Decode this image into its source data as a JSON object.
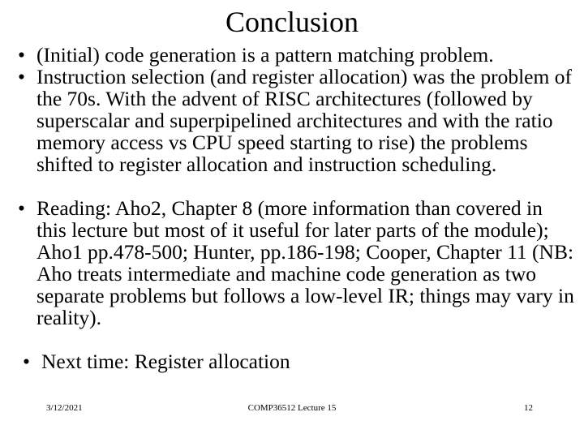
{
  "slide": {
    "title": "Conclusion",
    "bullets": [
      {
        "id": "bullet-initial-code-generation",
        "text": "(Initial) code generation is a pattern matching problem.",
        "marker": "•",
        "indent": 0,
        "gap_before": false
      },
      {
        "id": "bullet-instruction-selection",
        "text": "Instruction selection (and register allocation) was the problem of the 70s. With the advent of RISC architectures (followed by superscalar and superpipelined architectures and with the ratio memory access vs CPU speed starting to rise) the problems shifted to register allocation and instruction scheduling.",
        "marker": "•",
        "indent": 0,
        "gap_before": false
      },
      {
        "id": "bullet-reading",
        "text": "Reading: Aho2, Chapter 8 (more information than covered in this lecture but most of it useful for later parts of the module); Aho1 pp.478-500; Hunter, pp.186-198; Cooper, Chapter 11  (NB: Aho treats intermediate and machine code generation as two separate problems but follows a low-level IR; things may vary in reality).",
        "marker": "•",
        "indent": 0,
        "gap_before": true
      },
      {
        "id": "bullet-next-time",
        "text": "Next time: Register allocation",
        "marker": "•",
        "indent": 1,
        "gap_before": true
      }
    ],
    "footer": {
      "date": "3/12/2021",
      "center": "COMP36512 Lecture 15",
      "page_number": "12"
    },
    "colors": {
      "background": "#ffffff",
      "text": "#000000"
    }
  }
}
